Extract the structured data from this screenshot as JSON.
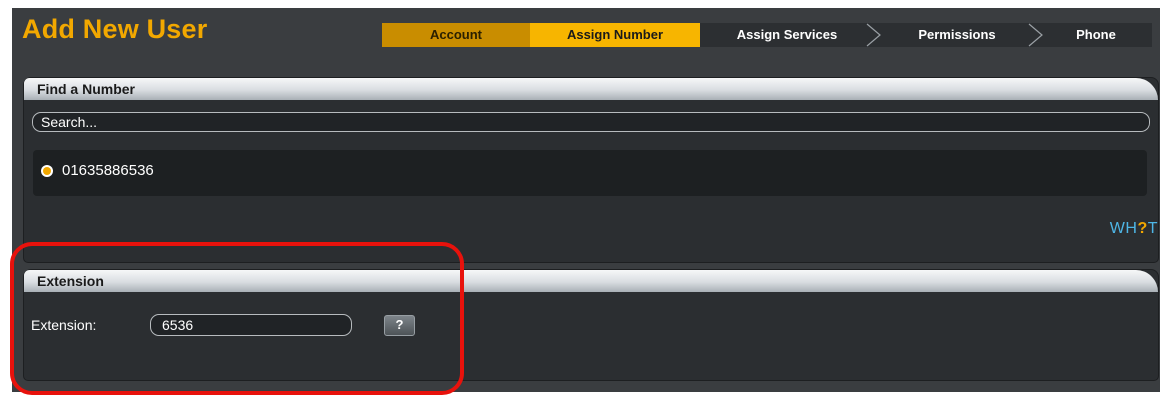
{
  "page": {
    "title": "Add New User"
  },
  "wizard": {
    "steps": [
      {
        "label": "Account",
        "state": "done"
      },
      {
        "label": "Assign Number",
        "state": "active"
      },
      {
        "label": "Assign Services",
        "state": "pending"
      },
      {
        "label": "Permissions",
        "state": "pending"
      },
      {
        "label": "Phone",
        "state": "pending"
      }
    ]
  },
  "find_number": {
    "header": "Find a Number",
    "search_placeholder": "Search...",
    "numbers": [
      {
        "value": "01635886536",
        "selected": true
      }
    ]
  },
  "brand": {
    "prefix": "WH",
    "accent": "?",
    "suffix": "T"
  },
  "extension": {
    "header": "Extension",
    "label": "Extension:",
    "value": "6536",
    "help_label": "?"
  },
  "colors": {
    "accent": "#f2a800",
    "panel_bg": "#2b2e31",
    "highlight": "#e8120c",
    "brand_blue": "#4eb6e6"
  }
}
